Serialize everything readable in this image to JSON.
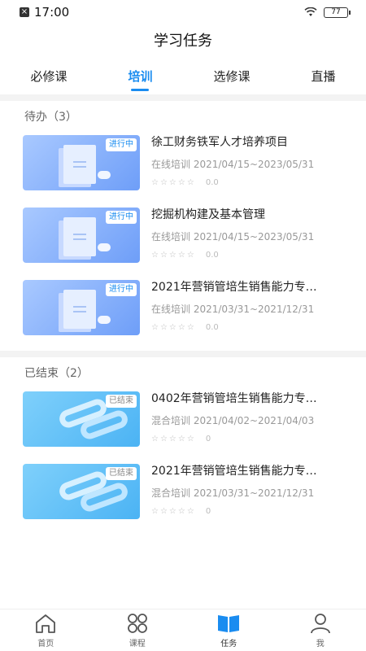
{
  "status": {
    "time": "17:00",
    "battery": "77"
  },
  "header": {
    "title": "学习任务"
  },
  "tabs": [
    {
      "label": "必修课",
      "active": false
    },
    {
      "label": "培训",
      "active": true
    },
    {
      "label": "选修课",
      "active": false
    },
    {
      "label": "直播",
      "active": false
    }
  ],
  "sections": {
    "todo": {
      "header": "待办（3）",
      "items": [
        {
          "name": "徐工财务铁军人才培养项目",
          "badge": "进行中",
          "meta": "在线培训 2021/04/15~2023/05/31",
          "stars": "☆☆☆☆☆",
          "score": "0.0"
        },
        {
          "name": "挖掘机构建及基本管理",
          "badge": "进行中",
          "meta": "在线培训 2021/04/15~2023/05/31",
          "stars": "☆☆☆☆☆",
          "score": "0.0"
        },
        {
          "name": "2021年营销管培生销售能力专…",
          "badge": "进行中",
          "meta": "在线培训 2021/03/31~2021/12/31",
          "stars": "☆☆☆☆☆",
          "score": "0.0"
        }
      ]
    },
    "ended": {
      "header": "已结束（2）",
      "items": [
        {
          "name": "0402年营销管培生销售能力专…",
          "badge": "已结束",
          "meta": "混合培训 2021/04/02~2021/04/03",
          "stars": "☆☆☆☆☆",
          "score": "0"
        },
        {
          "name": "2021年营销管培生销售能力专…",
          "badge": "已结束",
          "meta": "混合培训 2021/03/31~2021/12/31",
          "stars": "☆☆☆☆☆",
          "score": "0"
        }
      ]
    }
  },
  "bottom_nav": [
    {
      "label": "首页",
      "icon": "home-icon"
    },
    {
      "label": "课程",
      "icon": "grid-icon"
    },
    {
      "label": "任务",
      "icon": "book-icon",
      "active": true
    },
    {
      "label": "我",
      "icon": "user-icon"
    }
  ],
  "colors": {
    "accent": "#1a8cf0"
  }
}
